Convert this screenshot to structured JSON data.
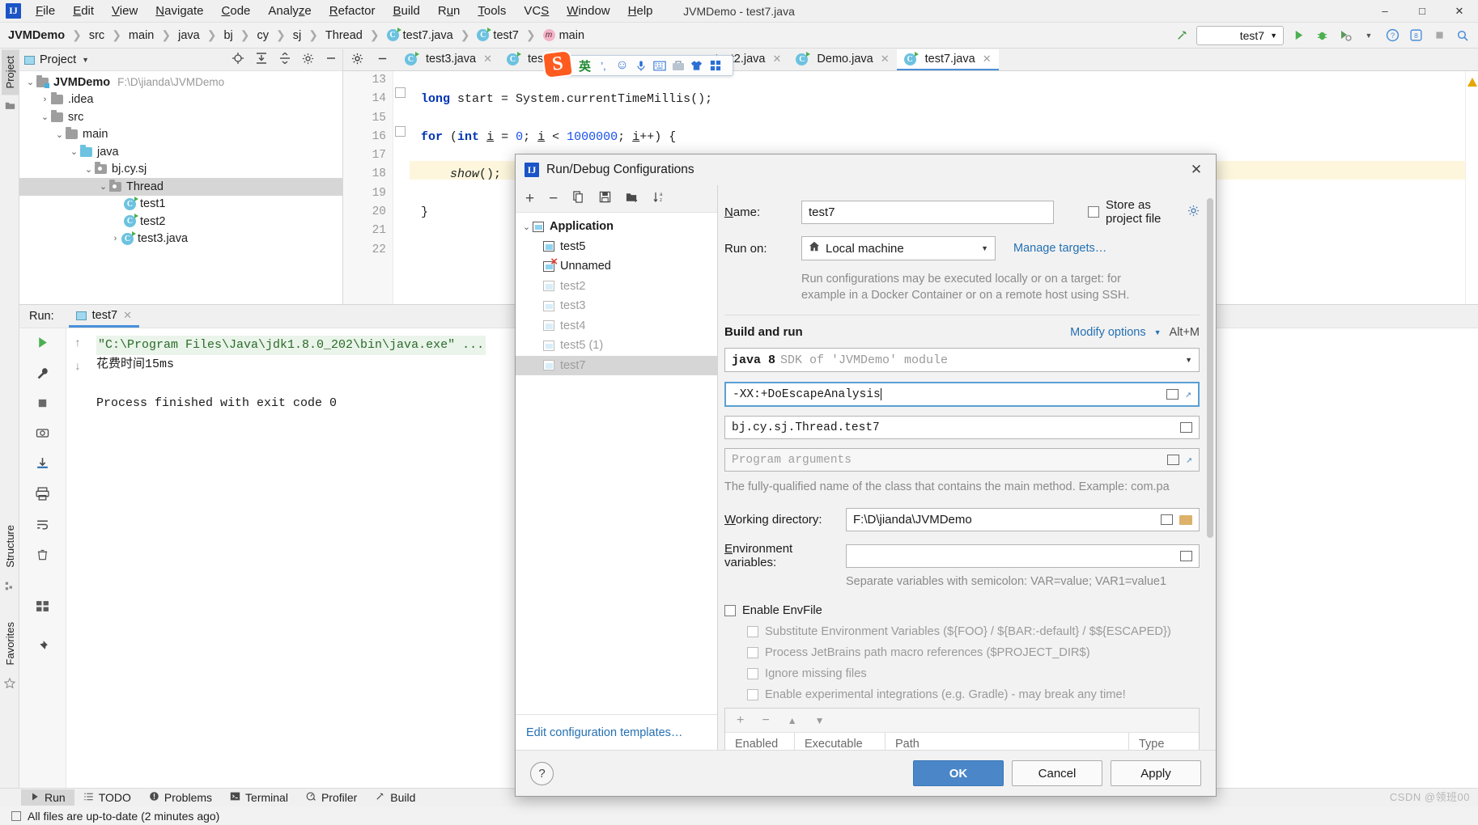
{
  "window": {
    "title": "JVMDemo - test7.java",
    "minimize": "–",
    "maximize": "□",
    "close": "✕"
  },
  "menu": [
    "File",
    "Edit",
    "View",
    "Navigate",
    "Code",
    "Analyze",
    "Refactor",
    "Build",
    "Run",
    "Tools",
    "VCS",
    "Window",
    "Help"
  ],
  "breadcrumb": [
    {
      "label": "JVMDemo",
      "icon": "none",
      "bold": true
    },
    {
      "label": "src",
      "icon": "none"
    },
    {
      "label": "main",
      "icon": "none"
    },
    {
      "label": "java",
      "icon": "none"
    },
    {
      "label": "bj",
      "icon": "none"
    },
    {
      "label": "cy",
      "icon": "none"
    },
    {
      "label": "sj",
      "icon": "none"
    },
    {
      "label": "Thread",
      "icon": "none"
    },
    {
      "label": "test7.java",
      "icon": "class-icon"
    },
    {
      "label": "test7",
      "icon": "class-icon"
    },
    {
      "label": "main",
      "icon": "method-icon"
    }
  ],
  "toolbar": {
    "build_icon": "hammer-icon",
    "run_config": "test7",
    "run_icon": "run-icon",
    "debug_icon": "debug-icon",
    "coverage_icon": "coverage-icon",
    "help_icon": "help-icon",
    "notifications_icon": "notifications-icon",
    "stop_icon": "stop-icon",
    "search_icon": "search-icon"
  },
  "project_panel": {
    "title": "Project",
    "icons": [
      "locate-icon",
      "expand-all-icon",
      "collapse-all-icon",
      "settings-icon",
      "hide-icon"
    ],
    "tree": [
      {
        "label": "JVMDemo",
        "path": "F:\\D\\jianda\\JVMDemo",
        "indent": 0,
        "twisty": "⌄",
        "icon": "folder-module",
        "bold": true
      },
      {
        "label": ".idea",
        "path": "",
        "indent": 1,
        "twisty": "›",
        "icon": "folder"
      },
      {
        "label": "src",
        "path": "",
        "indent": 1,
        "twisty": "⌄",
        "icon": "folder-src"
      },
      {
        "label": "main",
        "path": "",
        "indent": 2,
        "twisty": "⌄",
        "icon": "folder"
      },
      {
        "label": "java",
        "path": "",
        "indent": 3,
        "twisty": "⌄",
        "icon": "folder-java"
      },
      {
        "label": "bj.cy.sj",
        "path": "",
        "indent": 4,
        "twisty": "⌄",
        "icon": "folder-package"
      },
      {
        "label": "Thread",
        "path": "",
        "indent": 5,
        "twisty": "⌄",
        "icon": "folder-package",
        "selected": true
      },
      {
        "label": "test1",
        "path": "",
        "indent": 6,
        "twisty": "",
        "icon": "class-icon"
      },
      {
        "label": "test2",
        "path": "",
        "indent": 6,
        "twisty": "",
        "icon": "class-icon"
      },
      {
        "label": "test3.java",
        "path": "",
        "indent": 5,
        "twisty": "›",
        "icon": "class-icon"
      }
    ]
  },
  "editor": {
    "lead_icons": [
      "settings-icon",
      "minimize-icon"
    ],
    "tabs": [
      {
        "label": "test3.java",
        "icon": "class-icon",
        "active": false,
        "closable": true
      },
      {
        "label": "test5",
        "icon": "class-icon",
        "active": false,
        "closable": false
      },
      {
        "label": "test2.java",
        "icon": "class-icon",
        "active": false,
        "closable": true
      },
      {
        "label": "Demo.java",
        "icon": "class-icon",
        "active": false,
        "closable": true
      },
      {
        "label": "test7.java",
        "icon": "class-icon",
        "active": true,
        "closable": true
      }
    ],
    "line_numbers": [
      "13",
      "14",
      "15",
      "16",
      "17",
      "18",
      "19",
      "20",
      "21",
      "22"
    ],
    "lines": [
      "long start = System.currentTimeMillis();",
      "for (int i = 0; i < 1000000; i++) {",
      "    show();",
      "}",
      "",
      "",
      "",
      "",
      "",
      ""
    ],
    "highlight_line_index": 5,
    "warning_marker": "warning-icon"
  },
  "run_panel": {
    "label": "Run:",
    "tab": "test7",
    "tab_close": "✕",
    "side_icons": [
      "rerun-icon",
      "wrench-icon",
      "stop-icon",
      "camera-icon",
      "export-icon",
      "print-icon",
      "pin-icon",
      "layout-icon",
      "pin2-icon"
    ],
    "side_icons2": [
      "up-icon",
      "down-icon",
      "soft-wrap-icon",
      "scroll-end-icon",
      "trash-icon"
    ],
    "console": [
      {
        "text": "\"C:\\Program Files\\Java\\jdk1.8.0_202\\bin\\java.exe\" ...",
        "style": "cmd"
      },
      {
        "text": "花费时间15ms",
        "style": "out"
      },
      {
        "text": "",
        "style": "out"
      },
      {
        "text": "Process finished with exit code 0",
        "style": "done"
      }
    ]
  },
  "left_rail": {
    "top": [
      "Project"
    ],
    "bottom": [
      "Structure",
      "Favorites"
    ]
  },
  "bottom_tools": [
    {
      "label": "Run",
      "icon": "run-icon",
      "active": true
    },
    {
      "label": "TODO",
      "icon": "todo-icon",
      "active": false
    },
    {
      "label": "Problems",
      "icon": "problems-icon",
      "active": false
    },
    {
      "label": "Terminal",
      "icon": "terminal-icon",
      "active": false
    },
    {
      "label": "Profiler",
      "icon": "profiler-icon",
      "active": false
    },
    {
      "label": "Build",
      "icon": "build-icon",
      "active": false
    }
  ],
  "status_bar": {
    "text": "All files are up-to-date (2 minutes ago)",
    "icon": "checkbox-icon"
  },
  "watermark": "CSDN @领班00",
  "ime": {
    "logo": "S",
    "icons": [
      "英",
      "’,",
      "☺",
      "🎤",
      "⌨",
      "☰",
      "♟",
      "▦"
    ],
    "names": [
      "ime-mode-icon",
      "punctuation-icon",
      "emoji-icon",
      "voice-icon",
      "keyboard-icon",
      "toolbox-icon",
      "skin-icon",
      "apps-icon"
    ]
  },
  "dialog": {
    "title": "Run/Debug Configurations",
    "close": "✕",
    "left_tools": [
      "add-icon",
      "remove-icon",
      "copy-icon",
      "save-icon",
      "folder-icon",
      "sort-icon"
    ],
    "configs": [
      {
        "label": "Application",
        "type": "group",
        "bold": true,
        "twisty": "⌄",
        "dim": false
      },
      {
        "label": "test5",
        "type": "item",
        "dim": false
      },
      {
        "label": "Unnamed",
        "type": "item",
        "dim": false,
        "error": true
      },
      {
        "label": "test2",
        "type": "item",
        "dim": true
      },
      {
        "label": "test3",
        "type": "item",
        "dim": true
      },
      {
        "label": "test4",
        "type": "item",
        "dim": true
      },
      {
        "label": "test5 (1)",
        "type": "item",
        "dim": true
      },
      {
        "label": "test7",
        "type": "item",
        "dim": true,
        "selected": true
      }
    ],
    "edit_templates_link": "Edit configuration templates…",
    "name_label": "Name:",
    "name_value": "test7",
    "store_as_project_file": "Store as project file",
    "store_gear": "gear-icon",
    "run_on_label": "Run on:",
    "run_on_value": "Local machine",
    "run_on_icon": "home-icon",
    "manage_targets": "Manage targets…",
    "run_on_hint_line1": "Run configurations may be executed locally or on a target: for",
    "run_on_hint_line2": "example in a Docker Container or on a remote host using SSH.",
    "build_and_run": "Build and run",
    "modify_options": "Modify options",
    "modify_shortcut": "Alt+M",
    "sdk_main": "java 8",
    "sdk_detail": "SDK of 'JVMDemo' module",
    "vm_options": "-XX:+DoEscapeAnalysis",
    "main_class": "bj.cy.sj.Thread.test7",
    "program_args_placeholder": "Program arguments",
    "main_class_hint": "The fully-qualified name of the class that contains the main method. Example: com.pa",
    "working_dir_label": "Working directory:",
    "working_dir_value": "F:\\D\\jianda\\JVMDemo",
    "env_vars_label": "Environment variables:",
    "env_vars_value": "",
    "env_vars_hint": "Separate variables with semicolon: VAR=value; VAR1=value1",
    "enable_envfile": "Enable EnvFile",
    "envfile_options": [
      "Substitute Environment Variables (${FOO} / ${BAR:-default} / $${ESCAPED})",
      "Process JetBrains path macro references ($PROJECT_DIR$)",
      "Ignore missing files",
      "Enable experimental integrations (e.g. Gradle) - may break any time!"
    ],
    "envfile_table_tools": [
      "add-icon",
      "remove-icon",
      "move-up-icon",
      "move-down-icon"
    ],
    "envfile_columns": [
      "Enabled",
      "Executable",
      "Path",
      "Type"
    ],
    "help": "?",
    "ok": "OK",
    "cancel": "Cancel",
    "apply": "Apply"
  },
  "colors": {
    "accent": "#4a86c8",
    "link": "#2470b3",
    "selection": "#d6d6d6",
    "keyword": "#0033b3",
    "number": "#1750eb",
    "console_cmd": "#2a6b2a",
    "ime_orange": "#ff5b1f"
  }
}
